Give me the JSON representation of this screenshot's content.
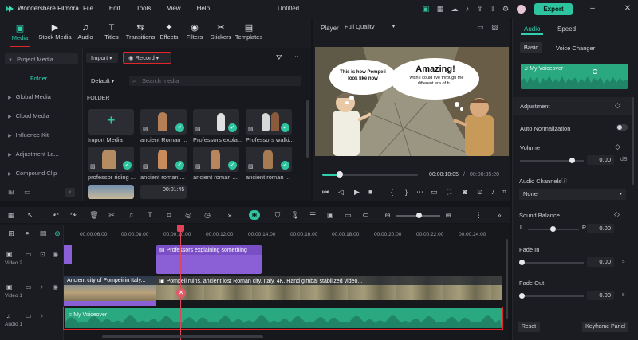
{
  "app": {
    "name": "Wondershare Filmora",
    "menu": [
      "File",
      "Edit",
      "Tools",
      "View",
      "Help"
    ],
    "doc_title": "Untitled",
    "export_label": "Export"
  },
  "lib_tabs": [
    {
      "label": "Media",
      "icon": "media-icon"
    },
    {
      "label": "Stock Media",
      "icon": "stock-media-icon"
    },
    {
      "label": "Audio",
      "icon": "audio-icon"
    },
    {
      "label": "Titles",
      "icon": "titles-icon"
    },
    {
      "label": "Transitions",
      "icon": "transitions-icon"
    },
    {
      "label": "Effects",
      "icon": "effects-icon"
    },
    {
      "label": "Filters",
      "icon": "filters-icon"
    },
    {
      "label": "Stickers",
      "icon": "stickers-icon"
    },
    {
      "label": "Templates",
      "icon": "templates-icon"
    }
  ],
  "sidebar": {
    "items": [
      "Project Media",
      "Folder",
      "Global Media",
      "Cloud Media",
      "Influence Kit",
      "Adjustment La...",
      "Compound Clip"
    ]
  },
  "media": {
    "import_label": "Import",
    "record_label": "Record",
    "sort_label": "Default",
    "search_placeholder": "Search media",
    "folder_label": "FOLDER",
    "items": [
      "Import Media",
      "ancient Roman ...",
      "Professors expla...",
      "Professors walki...",
      "professor riding ...",
      "ancient roman ...",
      "ancient roman ...",
      "ancient roman ..."
    ],
    "duration": "00:01:45"
  },
  "player": {
    "label": "Player",
    "quality": "Full Quality",
    "bubble_left": "This is how Pompeii look like now",
    "bubble_right_title": "Amazing!",
    "bubble_right_text": "I wish I could live through the different era of h...",
    "current_time": "00:00:10:05",
    "total_time": "00:00:35:20",
    "progress": 0.18
  },
  "right_panel": {
    "tabs": [
      "Audio",
      "Speed"
    ],
    "subtabs": [
      "Basic",
      "Voice Changer"
    ],
    "clip_name": "My Voiceover",
    "adjustment": "Adjustment",
    "auto_norm": "Auto Normalization",
    "volume": "Volume",
    "volume_value": "0.00",
    "volume_unit": "dB",
    "channels": "Audio Channels",
    "channels_value": "None",
    "balance": "Sound Balance",
    "balance_l": "L",
    "balance_r": "R",
    "balance_value": "0.00",
    "fade_in": "Fade In",
    "fade_in_value": "0.00",
    "fade_out": "Fade Out",
    "fade_out_value": "0.00",
    "unit_s": "s",
    "reset": "Reset",
    "keyframe": "Keyframe Panel"
  },
  "timeline": {
    "ticks": [
      "00:00:06:00",
      "00:00:08:00",
      "00:00:10:00",
      "00:00:12:00",
      "00:00:14:00",
      "00:00:16:00",
      "00:00:18:00",
      "00:00:20:00",
      "00:00:22:00",
      "00:00:24:00"
    ],
    "tracks": [
      "Video 2",
      "Video 1",
      "Audio 1"
    ],
    "clip_v2": "Professors explaining something",
    "clip_v1a": "Ancient city of Pompeii in Italy...",
    "clip_v1b": "Pompeii ruins, ancient lost Roman city, Italy, 4K. Hand gimbal stabilized video...",
    "clip_a1": "My Voiceover"
  },
  "colors": {
    "accent": "#2ec4a0",
    "highlight": "#e0252b",
    "video2": "#8b5fd6",
    "audio": "#2aa981"
  }
}
